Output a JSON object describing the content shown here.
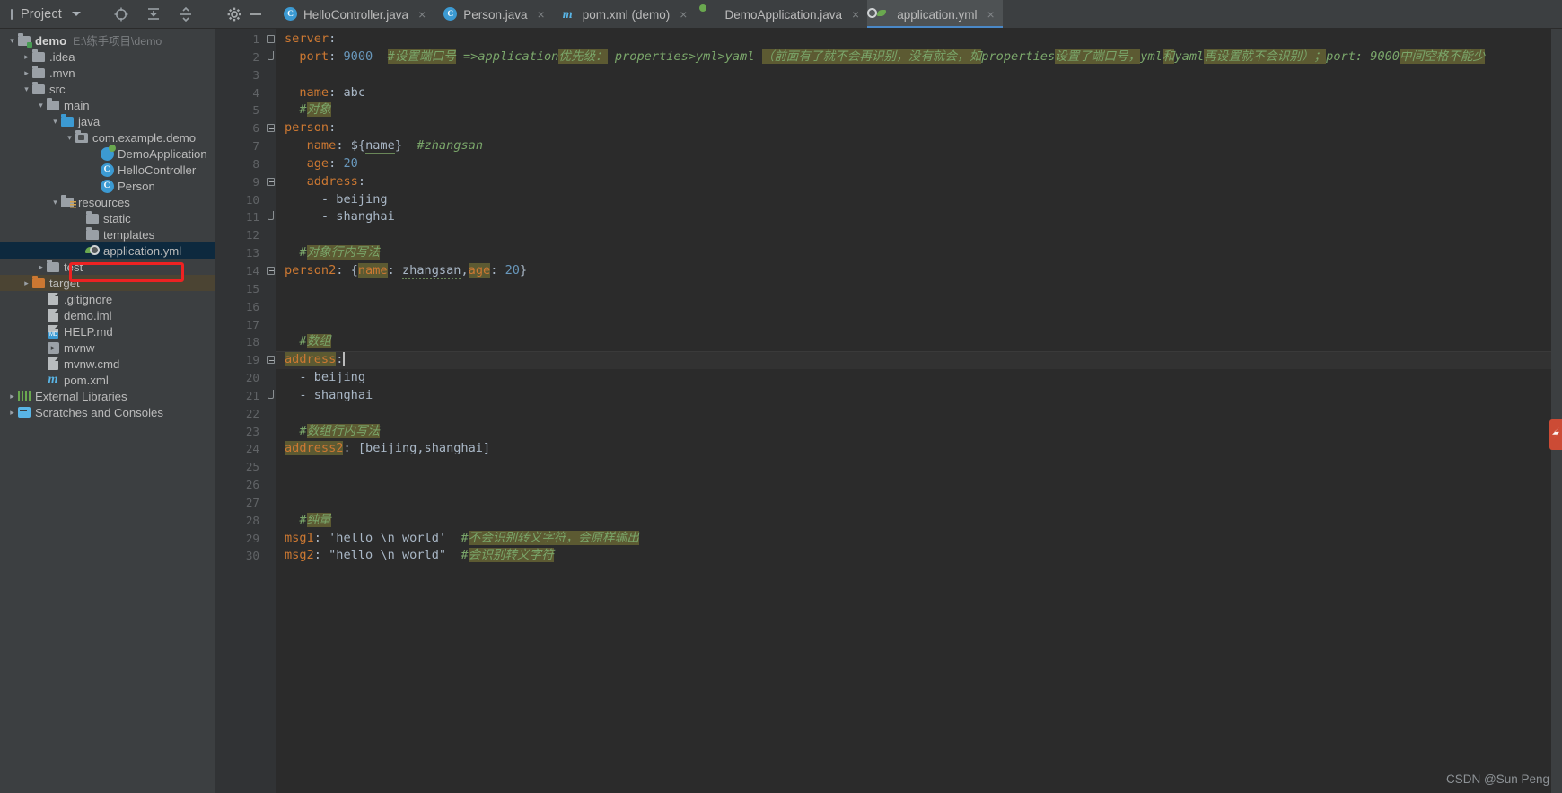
{
  "window": {
    "project_panel_title": "Project",
    "watermark": "CSDN @Sun  Peng"
  },
  "toolbar": {
    "icons": [
      "locate-icon",
      "collapse-all-icon",
      "expand-collapse-icon",
      "gear-icon",
      "minimize-icon"
    ]
  },
  "tabs": [
    {
      "label": "HelloController.java",
      "icon": "java-class-icon",
      "close": "×",
      "active": false
    },
    {
      "label": "Person.java",
      "icon": "java-class-icon",
      "close": "×",
      "active": false
    },
    {
      "label": "pom.xml (demo)",
      "icon": "maven-icon",
      "close": "×",
      "active": false
    },
    {
      "label": "DemoApplication.java",
      "icon": "spring-boot-icon",
      "close": "×",
      "active": false
    },
    {
      "label": "application.yml",
      "icon": "spring-yaml-icon",
      "close": "×",
      "active": true
    }
  ],
  "sidebar": {
    "items": [
      {
        "label": "demo",
        "sub": "E:\\练手项目\\demo",
        "indent": 0,
        "arrow": "⌄",
        "icon": "module-folder-icon",
        "bold": true,
        "state": "normal"
      },
      {
        "label": ".idea",
        "sub": "",
        "indent": 1,
        "arrow": "›",
        "icon": "folder-icon",
        "bold": false,
        "state": "normal"
      },
      {
        "label": ".mvn",
        "sub": "",
        "indent": 1,
        "arrow": "›",
        "icon": "folder-icon",
        "bold": false,
        "state": "normal"
      },
      {
        "label": "src",
        "sub": "",
        "indent": 1,
        "arrow": "⌄",
        "icon": "folder-icon",
        "bold": false,
        "state": "normal"
      },
      {
        "label": "main",
        "sub": "",
        "indent": 2,
        "arrow": "⌄",
        "icon": "folder-icon",
        "bold": false,
        "state": "normal"
      },
      {
        "label": "java",
        "sub": "",
        "indent": 3,
        "arrow": "⌄",
        "icon": "source-folder-icon",
        "bold": false,
        "state": "normal"
      },
      {
        "label": "com.example.demo",
        "sub": "",
        "indent": 4,
        "arrow": "⌄",
        "icon": "package-icon",
        "bold": false,
        "state": "normal"
      },
      {
        "label": "DemoApplication",
        "sub": "",
        "indent": 5,
        "arrow": "",
        "icon": "spring-boot-class-icon",
        "bold": false,
        "state": "normal"
      },
      {
        "label": "HelloController",
        "sub": "",
        "indent": 5,
        "arrow": "",
        "icon": "java-class-icon",
        "bold": false,
        "state": "normal"
      },
      {
        "label": "Person",
        "sub": "",
        "indent": 5,
        "arrow": "",
        "icon": "java-class-icon",
        "bold": false,
        "state": "normal"
      },
      {
        "label": "resources",
        "sub": "",
        "indent": 3,
        "arrow": "⌄",
        "icon": "resources-folder-icon",
        "bold": false,
        "state": "normal"
      },
      {
        "label": "static",
        "sub": "",
        "indent": 4,
        "arrow": "",
        "icon": "folder-icon",
        "bold": false,
        "state": "normal"
      },
      {
        "label": "templates",
        "sub": "",
        "indent": 4,
        "arrow": "",
        "icon": "folder-icon",
        "bold": false,
        "state": "normal"
      },
      {
        "label": "application.yml",
        "sub": "",
        "indent": 4,
        "arrow": "",
        "icon": "spring-yaml-icon",
        "bold": false,
        "state": "selected"
      },
      {
        "label": "test",
        "sub": "",
        "indent": 2,
        "arrow": "›",
        "icon": "folder-icon",
        "bold": false,
        "state": "normal"
      },
      {
        "label": "target",
        "sub": "",
        "indent": 1,
        "arrow": "›",
        "icon": "target-folder-icon",
        "bold": false,
        "state": "highlight"
      },
      {
        "label": ".gitignore",
        "sub": "",
        "indent": 1,
        "arrow": "",
        "icon": "gitignore-file-icon",
        "bold": false,
        "state": "normal"
      },
      {
        "label": "demo.iml",
        "sub": "",
        "indent": 1,
        "arrow": "",
        "icon": "iml-file-icon",
        "bold": false,
        "state": "normal"
      },
      {
        "label": "HELP.md",
        "sub": "",
        "indent": 1,
        "arrow": "",
        "icon": "markdown-file-icon",
        "bold": false,
        "state": "normal"
      },
      {
        "label": "mvnw",
        "sub": "",
        "indent": 1,
        "arrow": "",
        "icon": "shell-file-icon",
        "bold": false,
        "state": "normal"
      },
      {
        "label": "mvnw.cmd",
        "sub": "",
        "indent": 1,
        "arrow": "",
        "icon": "cmd-file-icon",
        "bold": false,
        "state": "normal"
      },
      {
        "label": "pom.xml",
        "sub": "",
        "indent": 1,
        "arrow": "",
        "icon": "maven-icon",
        "bold": false,
        "state": "normal"
      },
      {
        "label": "External Libraries",
        "sub": "",
        "indent": 0,
        "arrow": "›",
        "icon": "libraries-icon",
        "bold": false,
        "state": "normal"
      },
      {
        "label": "Scratches and Consoles",
        "sub": "",
        "indent": 0,
        "arrow": "›",
        "icon": "scratches-icon",
        "bold": false,
        "state": "normal"
      }
    ]
  },
  "editor": {
    "filename": "application.yml",
    "line_count": 30,
    "line_numbers": [
      "1",
      "2",
      "3",
      "4",
      "5",
      "6",
      "7",
      "8",
      "9",
      "10",
      "11",
      "12",
      "13",
      "14",
      "15",
      "16",
      "17",
      "18",
      "19",
      "20",
      "21",
      "22",
      "23",
      "24",
      "25",
      "26",
      "27",
      "28",
      "29",
      "30"
    ],
    "caret_line": 19,
    "code_lines": [
      {
        "n": 1,
        "text": "server:"
      },
      {
        "n": 2,
        "text": "  port: 9000  #设置端口号 =>application优先级: properties>yml>yaml（前面有了就不会再识别，没有就会，如properties设置了端口号，yml和yaml再设置就不会识别）；port: 9000中间空格不能少"
      },
      {
        "n": 3,
        "text": ""
      },
      {
        "n": 4,
        "text": "  name: abc"
      },
      {
        "n": 5,
        "text": "  #对象"
      },
      {
        "n": 6,
        "text": "person:"
      },
      {
        "n": 7,
        "text": "   name: ${name}  #zhangsan"
      },
      {
        "n": 8,
        "text": "   age: 20"
      },
      {
        "n": 9,
        "text": "   address:"
      },
      {
        "n": 10,
        "text": "     - beijing"
      },
      {
        "n": 11,
        "text": "     - shanghai"
      },
      {
        "n": 12,
        "text": ""
      },
      {
        "n": 13,
        "text": "  #对象行内写法"
      },
      {
        "n": 14,
        "text": "person2: {name: zhangsan,age: 20}"
      },
      {
        "n": 15,
        "text": ""
      },
      {
        "n": 16,
        "text": ""
      },
      {
        "n": 17,
        "text": ""
      },
      {
        "n": 18,
        "text": "  #数组"
      },
      {
        "n": 19,
        "text": "address:"
      },
      {
        "n": 20,
        "text": "  - beijing"
      },
      {
        "n": 21,
        "text": "  - shanghai"
      },
      {
        "n": 22,
        "text": ""
      },
      {
        "n": 23,
        "text": "  #数组行内写法"
      },
      {
        "n": 24,
        "text": "address2: [beijing,shanghai]"
      },
      {
        "n": 25,
        "text": ""
      },
      {
        "n": 26,
        "text": ""
      },
      {
        "n": 27,
        "text": ""
      },
      {
        "n": 28,
        "text": "  #纯量"
      },
      {
        "n": 29,
        "text": "msg1: 'hello \\n world'  #不会识别转义字符，会原样输出"
      },
      {
        "n": 30,
        "text": "msg2: \"hello \\n world\"  #会识别转义字符"
      }
    ],
    "tokens": {
      "l1_key": "server",
      "l2_key": "port",
      "l2_val": "9000",
      "l2_c1": "#设置端口号",
      "l2_c2": " =>application",
      "l2_c3": "优先级：",
      "l2_c4": " properties>yml>yaml ",
      "l2_c5": "（前面有了就不会再识别，没有就会，如",
      "l2_c6": "properties",
      "l2_c7": "设置了端口号，",
      "l2_c8": "yml",
      "l2_c9": "和",
      "l2_c10": "yaml",
      "l2_c11": "再设置就不会识别）；",
      "l2_c12": "port: 9000",
      "l2_c13": "中间空格不能少",
      "l4_key": "name",
      "l4_val": "abc",
      "l5_c": "#",
      "l5_cn": "对象",
      "l6_key": "person",
      "l7_key": "name",
      "l7_var": "name",
      "l7_c": "#zhangsan",
      "l8_key": "age",
      "l8_val": "20",
      "l9_key": "address",
      "l10_val": "- beijing",
      "l11_val": "- shanghai",
      "l13_c": "#",
      "l13_cn": "对象行内写法",
      "l14_key": "person2",
      "l14_k1": "name",
      "l14_v1": "zhangsan",
      "l14_k2": "age",
      "l14_v2": "20",
      "l18_c": "#",
      "l18_cn": "数组",
      "l19_key": "address",
      "l20_val": "- beijing",
      "l21_val": "- shanghai",
      "l23_c": "#",
      "l23_cn": "数组行内写法",
      "l24_key": "address2",
      "l24_val": "[beijing,shanghai]",
      "l28_c": "#",
      "l28_cn": "纯量",
      "l29_key": "msg1",
      "l29_val": "'hello \\n world'",
      "l29_c": "#",
      "l29_cn": "不会识别转义字符，会原样输出",
      "l30_key": "msg2",
      "l30_val": "\"hello \\n world\"",
      "l30_c": "#",
      "l30_cn": "会识别转义字符"
    }
  },
  "colors": {
    "bg_panel": "#3c3f41",
    "bg_editor": "#2b2b2b",
    "gutter": "#313335",
    "key": "#cc7832",
    "number": "#6897bb",
    "comment": "#7aa66a",
    "comment_highlight": "#5c5a32",
    "selection": "#0d293e",
    "annotation_red": "#ee2222",
    "tab_accent": "#4a88c7"
  }
}
